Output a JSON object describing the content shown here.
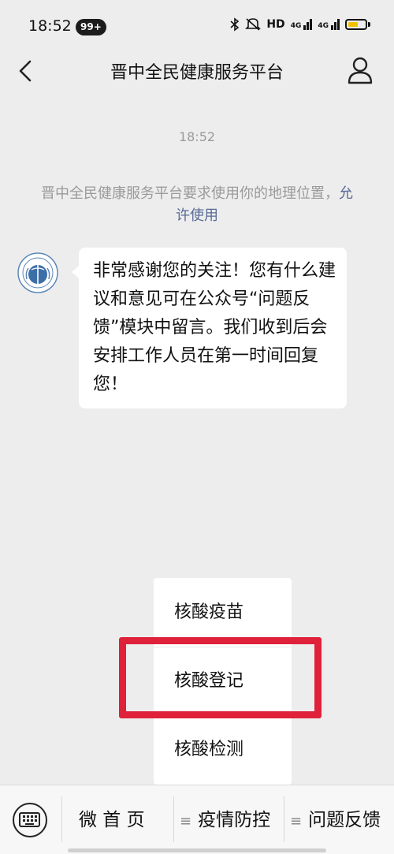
{
  "status_bar": {
    "time": "18:52",
    "badge": "99+",
    "network_label": "HD",
    "signal_1": "4G",
    "signal_2": "4G"
  },
  "nav": {
    "title": "晋中全民健康服务平台"
  },
  "chat": {
    "timestamp": "18:52",
    "system_message": "晋中全民健康服务平台要求使用你的地理位置，",
    "allow_link": "允许使用",
    "bubble_text": "非常感谢您的关注！您有什么建议和意见可在公众号“问题反馈”模块中留言。我们收到后会安排工作人员在第一时间回复您！"
  },
  "popup_menu": {
    "items": [
      {
        "label": "核酸疫苗"
      },
      {
        "label": "核酸登记"
      },
      {
        "label": "核酸检测"
      }
    ],
    "highlight_color": "#e0213a"
  },
  "bottom_menu": {
    "tabs": [
      {
        "label": "微 首 页"
      },
      {
        "label": "疫情防控"
      },
      {
        "label": "问题反馈"
      }
    ]
  },
  "colors": {
    "link": "#576b95",
    "background": "#ededed",
    "bubble": "#ffffff"
  }
}
